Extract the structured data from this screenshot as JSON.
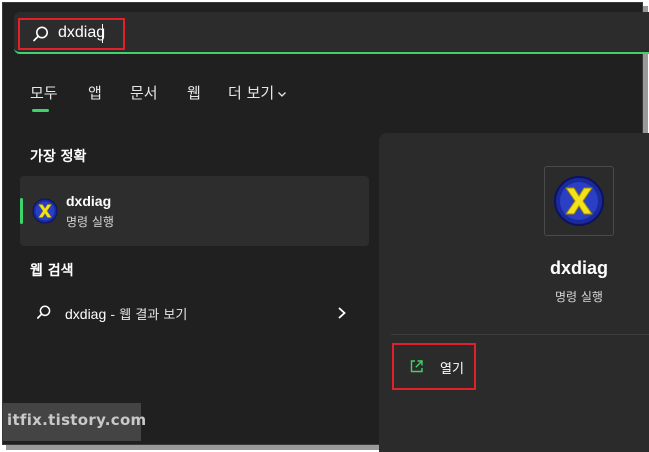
{
  "search": {
    "query": "dxdiag"
  },
  "tabs": [
    {
      "label": "모두"
    },
    {
      "label": "앱"
    },
    {
      "label": "문서"
    },
    {
      "label": "웹"
    },
    {
      "label": "더 보기"
    }
  ],
  "best_match": {
    "section_title": "가장 정확",
    "name": "dxdiag",
    "subtitle": "명령 실행",
    "icon": "directx-icon"
  },
  "web_search": {
    "section_title": "웹 검색",
    "query": "dxdiag",
    "suffix": " - 웹 결과 보기"
  },
  "detail": {
    "name": "dxdiag",
    "subtitle": "명령 실행",
    "open_label": "열기",
    "icon": "directx-icon"
  },
  "watermark": "itfix.tistory.com",
  "colors": {
    "accent": "#3fd36b",
    "highlight": "#e2202c",
    "background": "#202020",
    "panel": "#2b2b2b"
  }
}
